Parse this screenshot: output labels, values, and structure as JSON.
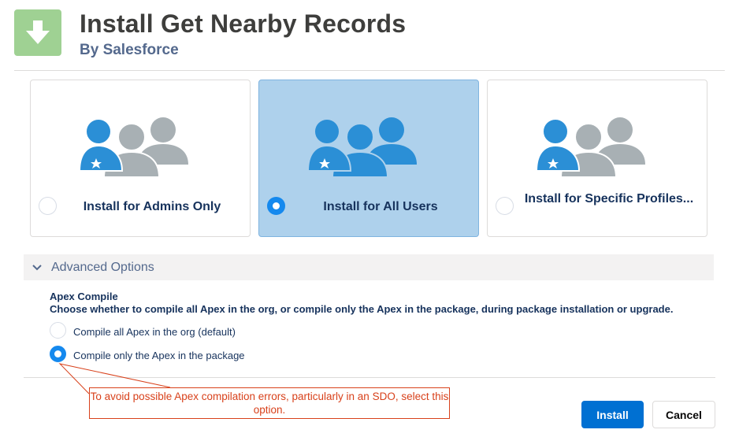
{
  "header": {
    "title": "Install Get Nearby Records",
    "byline": "By Salesforce",
    "icon": "download-arrow-icon",
    "icon_color": "#9fd193"
  },
  "install_options": [
    {
      "label": "Install for Admins Only",
      "selected": false,
      "icon": "users-admin-highlighted-icon"
    },
    {
      "label": "Install for All Users",
      "selected": true,
      "icon": "users-all-highlighted-icon"
    },
    {
      "label": "Install for Specific Profiles...",
      "selected": false,
      "icon": "users-specific-icon"
    }
  ],
  "advanced": {
    "label": "Advanced Options",
    "expanded": true,
    "apex_title": "Apex Compile",
    "apex_description": "Choose whether to compile all Apex in the org, or compile only the Apex in the package, during package installation or upgrade.",
    "options": [
      {
        "label": "Compile all Apex in the org (default)",
        "selected": false
      },
      {
        "label": "Compile only the Apex in the package",
        "selected": true
      }
    ]
  },
  "callout": {
    "text": "To avoid possible Apex compilation errors, particularly in an SDO, select this option.",
    "color": "#d8411b"
  },
  "buttons": {
    "install": "Install",
    "cancel": "Cancel"
  },
  "colors": {
    "brand_blue": "#0070d2",
    "selected_card": "#aed1ec",
    "person_blue": "#2b8fd6",
    "person_gray": "#a8b0b4"
  }
}
